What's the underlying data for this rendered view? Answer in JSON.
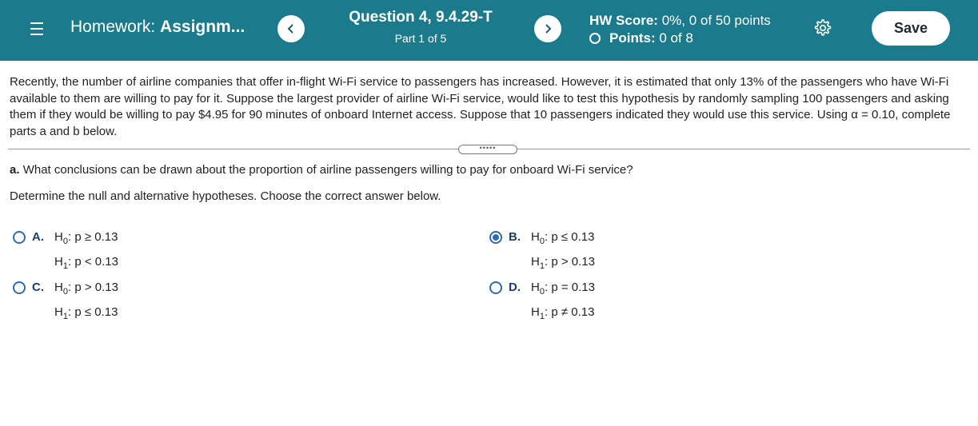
{
  "header": {
    "title_prefix": "Homework:",
    "title_main": "Assignm...",
    "question_title": "Question 4, 9.4.29-T",
    "question_part": "Part 1 of 5",
    "score_label": "HW Score:",
    "score_value": "0%, 0 of 50 points",
    "points_label": "Points:",
    "points_value": "0 of 8",
    "save_label": "Save",
    "bg_color": "#1b7a8c"
  },
  "problem_text": "Recently, the number of airline companies that offer in-flight Wi-Fi service to passengers has increased. However, it is estimated that only 13% of the passengers who have Wi-Fi available to them are willing to pay for it. Suppose the largest provider of airline Wi-Fi service, would like to test this hypothesis by randomly sampling 100 passengers and asking them if they would be willing to pay $4.95 for 90 minutes of onboard Internet access. Suppose that 10 passengers indicated they would use this service. Using α = 0.10, complete parts a and b below.",
  "expand_label": "•••••",
  "part_a": {
    "label": "a.",
    "question": "What conclusions can be drawn about the proportion of airline passengers willing to pay for onboard Wi-Fi service?",
    "instruction": "Determine the null and alternative hypotheses. Choose the correct answer below."
  },
  "choices": [
    {
      "letter": "A.",
      "h0": "p ≥ 0.13",
      "h1": "p < 0.13",
      "selected": false
    },
    {
      "letter": "B.",
      "h0": "p ≤ 0.13",
      "h1": "p > 0.13",
      "selected": true
    },
    {
      "letter": "C.",
      "h0": "p > 0.13",
      "h1": "p ≤ 0.13",
      "selected": false
    },
    {
      "letter": "D.",
      "h0": "p = 0.13",
      "h1": "p ≠ 0.13",
      "selected": false
    }
  ],
  "hyp_labels": {
    "h": "H",
    "sub0": "0",
    "sub1": "1",
    "colon": ":"
  }
}
